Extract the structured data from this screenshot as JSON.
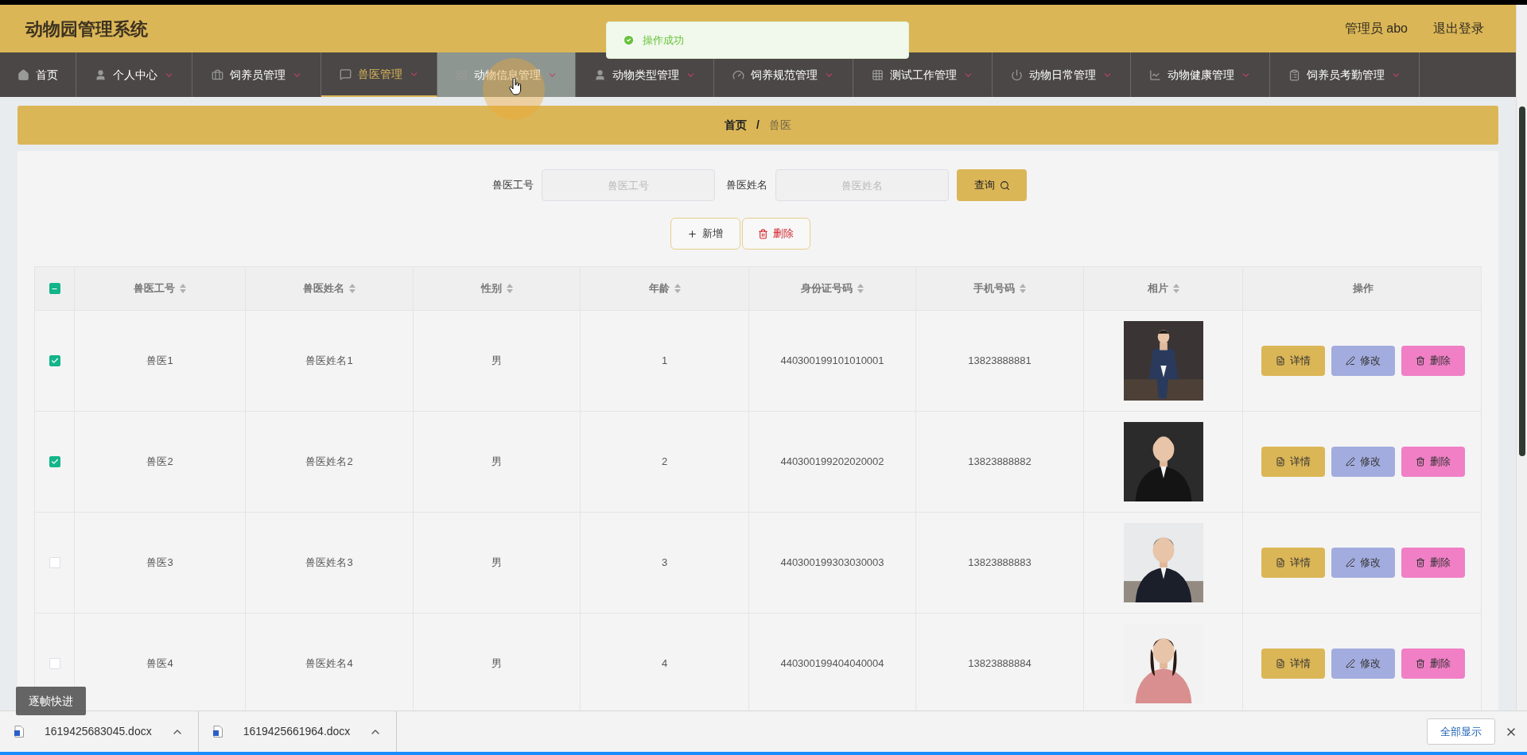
{
  "header": {
    "title": "动物园管理系统",
    "user": "管理员 abo",
    "logout": "退出登录"
  },
  "toast": {
    "message": "操作成功"
  },
  "nav": [
    {
      "label": "首页",
      "selected": false,
      "hovered": false,
      "dropdown": false
    },
    {
      "label": "个人中心",
      "selected": false,
      "hovered": false,
      "dropdown": true
    },
    {
      "label": "饲养员管理",
      "selected": false,
      "hovered": false,
      "dropdown": true
    },
    {
      "label": "兽医管理",
      "selected": true,
      "hovered": false,
      "dropdown": true
    },
    {
      "label": "动物信息管理",
      "selected": false,
      "hovered": true,
      "dropdown": true
    },
    {
      "label": "动物类型管理",
      "selected": false,
      "hovered": false,
      "dropdown": true
    },
    {
      "label": "饲养规范管理",
      "selected": false,
      "hovered": false,
      "dropdown": true
    },
    {
      "label": "测试工作管理",
      "selected": false,
      "hovered": false,
      "dropdown": true
    },
    {
      "label": "动物日常管理",
      "selected": false,
      "hovered": false,
      "dropdown": true
    },
    {
      "label": "动物健康管理",
      "selected": false,
      "hovered": false,
      "dropdown": true
    },
    {
      "label": "饲养员考勤管理",
      "selected": false,
      "hovered": false,
      "dropdown": true
    }
  ],
  "breadcrumb": {
    "home": "首页",
    "separator": "/",
    "current": "兽医"
  },
  "search": {
    "fields": [
      {
        "label": "兽医工号",
        "placeholder": "兽医工号"
      },
      {
        "label": "兽医姓名",
        "placeholder": "兽医姓名"
      }
    ],
    "button": "查询"
  },
  "toolbar": [
    {
      "kind": "add",
      "label": "新增"
    },
    {
      "kind": "delete",
      "label": "删除"
    }
  ],
  "table": {
    "header_checkbox": {
      "indeterminate": true
    },
    "columns": [
      {
        "label": "兽医工号",
        "sortable": true
      },
      {
        "label": "兽医姓名",
        "sortable": true
      },
      {
        "label": "性别",
        "sortable": true
      },
      {
        "label": "年龄",
        "sortable": true
      },
      {
        "label": "身份证号码",
        "sortable": true
      },
      {
        "label": "手机号码",
        "sortable": true
      },
      {
        "label": "相片",
        "sortable": true
      },
      {
        "label": "操作",
        "sortable": false
      }
    ],
    "rows": [
      {
        "checked": true,
        "cells": [
          "兽医1",
          "兽医姓名1",
          "男",
          "1",
          "440300199101010001",
          "13823888881"
        ],
        "photo": {
          "kind": "picture"
        },
        "actions": [
          {
            "kind": "detail",
            "label": "详情"
          },
          {
            "kind": "edit",
            "label": "修改"
          },
          {
            "kind": "delete",
            "label": "删除"
          }
        ]
      },
      {
        "checked": true,
        "cells": [
          "兽医2",
          "兽医姓名2",
          "男",
          "2",
          "440300199202020002",
          "13823888882"
        ],
        "photo": {
          "kind": "picture"
        },
        "actions": [
          {
            "kind": "detail",
            "label": "详情"
          },
          {
            "kind": "edit",
            "label": "修改"
          },
          {
            "kind": "delete",
            "label": "删除"
          }
        ]
      },
      {
        "checked": false,
        "cells": [
          "兽医3",
          "兽医姓名3",
          "男",
          "3",
          "440300199303030003",
          "13823888883"
        ],
        "photo": {
          "kind": "picture"
        },
        "actions": [
          {
            "kind": "detail",
            "label": "详情"
          },
          {
            "kind": "edit",
            "label": "修改"
          },
          {
            "kind": "delete",
            "label": "删除"
          }
        ]
      },
      {
        "checked": false,
        "cells": [
          "兽医4",
          "兽医姓名4",
          "男",
          "4",
          "440300199404040004",
          "13823888884"
        ],
        "photo": {
          "kind": "picture"
        },
        "actions": [
          {
            "kind": "detail",
            "label": "详情"
          },
          {
            "kind": "edit",
            "label": "修改"
          },
          {
            "kind": "delete",
            "label": "删除"
          }
        ]
      }
    ]
  },
  "downloads": {
    "files": [
      "1619425683045.docx",
      "1619425661964.docx"
    ],
    "show_all": "全部显示"
  },
  "player_tooltip": "逐帧快进"
}
